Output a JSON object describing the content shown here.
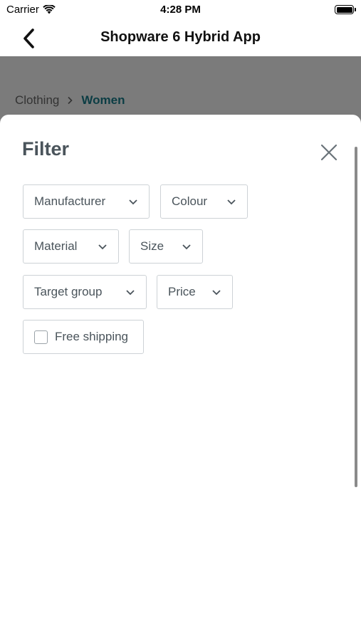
{
  "status_bar": {
    "carrier": "Carrier",
    "time": "4:28 PM"
  },
  "navbar": {
    "title": "Shopware 6 Hybrid App",
    "back_icon": "chevron-left-icon"
  },
  "breadcrumb": {
    "items": [
      "Clothing",
      "Women"
    ],
    "separator_icon": "chevron-right-icon"
  },
  "filter_sheet": {
    "title": "Filter",
    "close_icon": "close-icon",
    "filters": [
      {
        "label": "Manufacturer",
        "icon": "chevron-down-icon"
      },
      {
        "label": "Colour",
        "icon": "chevron-down-icon"
      },
      {
        "label": "Material",
        "icon": "chevron-down-icon"
      },
      {
        "label": "Size",
        "icon": "chevron-down-icon"
      },
      {
        "label": "Target group",
        "icon": "chevron-down-icon"
      },
      {
        "label": "Price",
        "icon": "chevron-down-icon"
      }
    ],
    "free_shipping": {
      "label": "Free shipping",
      "checked": false
    }
  },
  "colors": {
    "accent": "#0b3d44",
    "text": "#4a545b",
    "border": "#cdd2d6",
    "overlay": "#7b7b7b"
  }
}
